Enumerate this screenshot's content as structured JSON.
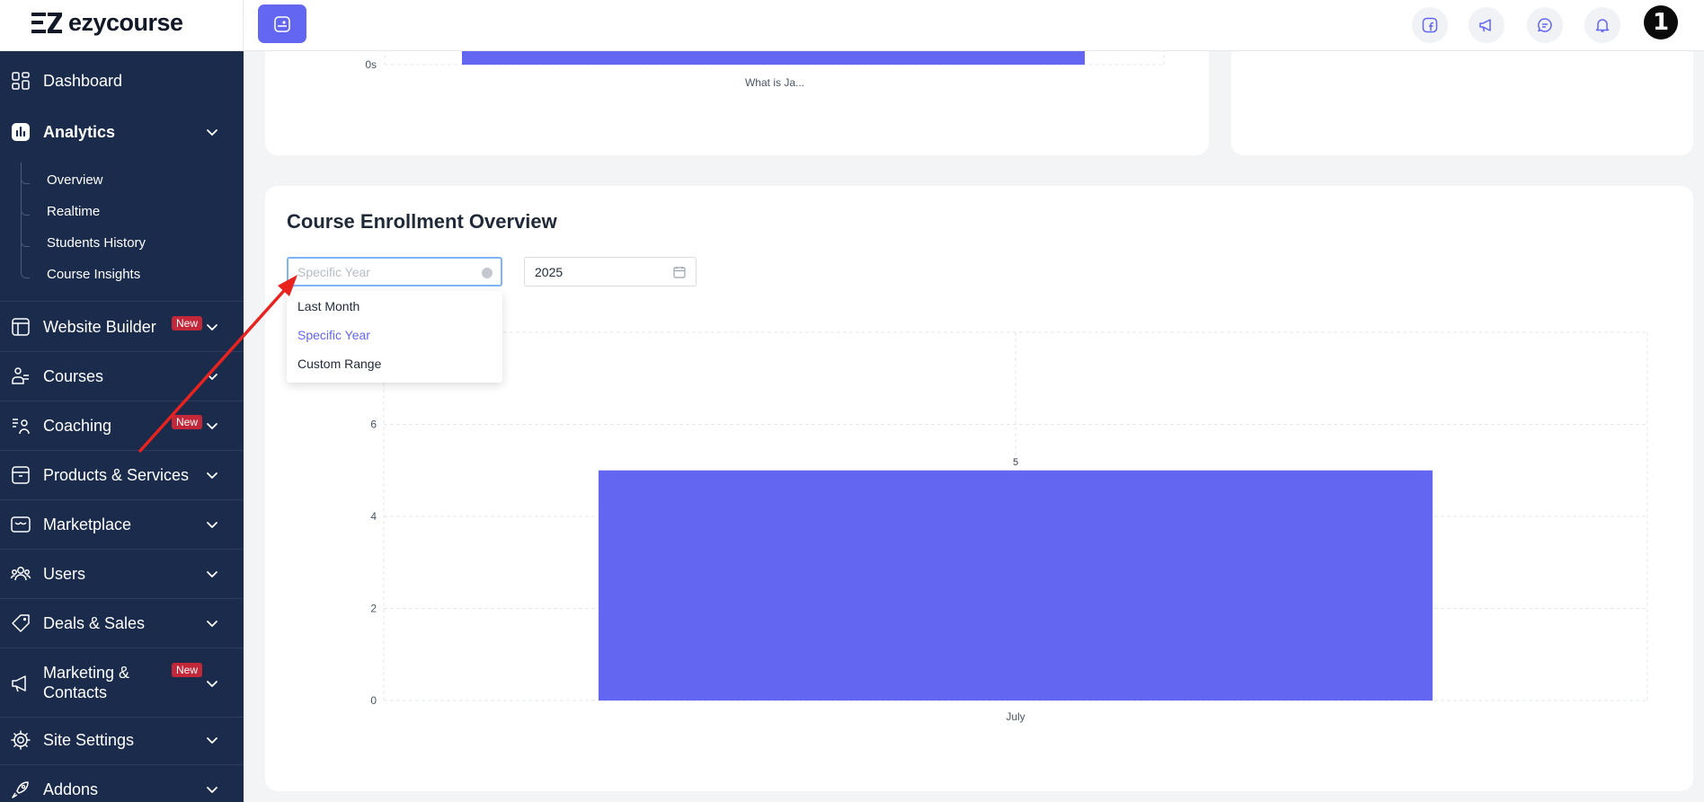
{
  "app": {
    "brand": "ezycourse"
  },
  "sidebar": {
    "dashboard": "Dashboard",
    "analytics": "Analytics",
    "analytics_sub": [
      "Overview",
      "Realtime",
      "Students History",
      "Course Insights"
    ],
    "website_builder": "Website Builder",
    "courses": "Courses",
    "coaching": "Coaching",
    "products_services": "Products & Services",
    "marketplace": "Marketplace",
    "users": "Users",
    "deals_sales": "Deals & Sales",
    "marketing_line1": "Marketing &",
    "marketing_line2": "Contacts",
    "site_settings": "Site Settings",
    "addons": "Addons",
    "new_badge": "New"
  },
  "top_chart": {
    "y_tick": "0s",
    "x_label": "What is Ja..."
  },
  "enrollment": {
    "title": "Course Enrollment Overview",
    "period_placeholder": "Specific Year",
    "year_value": "2025",
    "dropdown_options": [
      "Last Month",
      "Specific Year",
      "Custom Range"
    ],
    "selected_option": "Specific Year"
  },
  "chart_data": {
    "type": "bar",
    "categories": [
      "July"
    ],
    "values": [
      5
    ],
    "y_ticks": [
      0,
      2,
      4,
      6
    ],
    "ylim": [
      0,
      8
    ],
    "data_labels": [
      "5"
    ],
    "bar_color": "#6366f1",
    "grid": true
  },
  "colors": {
    "accent": "#6366f1",
    "sidebar_bg": "#1a2b4b",
    "badge": "#c2283a",
    "annotation_arrow": "#e8231f"
  }
}
